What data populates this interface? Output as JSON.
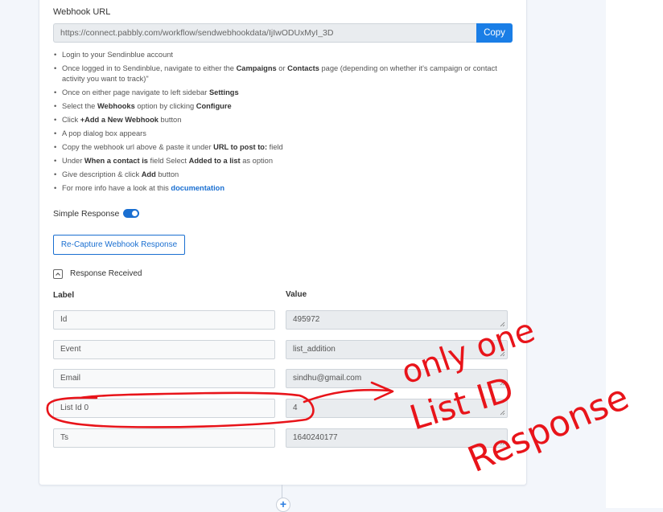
{
  "webhook": {
    "label": "Webhook URL",
    "url": "https://connect.pabbly.com/workflow/sendwebhookdata/IjIwODUxMyI_3D",
    "copy_label": "Copy"
  },
  "instructions": [
    {
      "parts": [
        "Login to your Sendinblue account"
      ]
    },
    {
      "parts": [
        "Once logged in to Sendinblue, navigate to either the ",
        "Campaigns",
        " or ",
        "Contacts",
        " page (depending on whether it's campaign or contact activity you want to track)\""
      ]
    },
    {
      "parts": [
        "Once on either page navigate to left sidebar ",
        "Settings"
      ]
    },
    {
      "parts": [
        "Select the ",
        "Webhooks",
        " option by clicking ",
        "Configure"
      ]
    },
    {
      "parts": [
        "Click ",
        "+Add a New Webhook",
        " button"
      ]
    },
    {
      "parts": [
        "A pop dialog box appears"
      ]
    },
    {
      "parts": [
        "Copy the webhook url above & paste it under ",
        "URL to post to:",
        " field"
      ]
    },
    {
      "parts": [
        "Under ",
        "When a contact is",
        " field Select ",
        "Added to a list",
        " as option"
      ]
    },
    {
      "parts": [
        "Give description & click ",
        "Add",
        " button"
      ]
    },
    {
      "parts": [
        "For more info have a look at this ",
        "documentation"
      ]
    }
  ],
  "simple_response": {
    "label": "Simple Response",
    "enabled": true
  },
  "recapture_label": "Re-Capture Webhook Response",
  "response_received": "Response Received",
  "columns": {
    "label": "Label",
    "value": "Value"
  },
  "rows": [
    {
      "label": "Id",
      "value": "495972"
    },
    {
      "label": "Event",
      "value": "list_addition"
    },
    {
      "label": "Email",
      "value": "sindhu@gmail.com"
    },
    {
      "label": "List Id 0",
      "value": "4"
    },
    {
      "label": "Ts",
      "value": "1640240177"
    }
  ],
  "annotation": {
    "lines": [
      "only one",
      "List ID",
      "Response"
    ],
    "color": "#e8141a"
  },
  "add_step": "+"
}
